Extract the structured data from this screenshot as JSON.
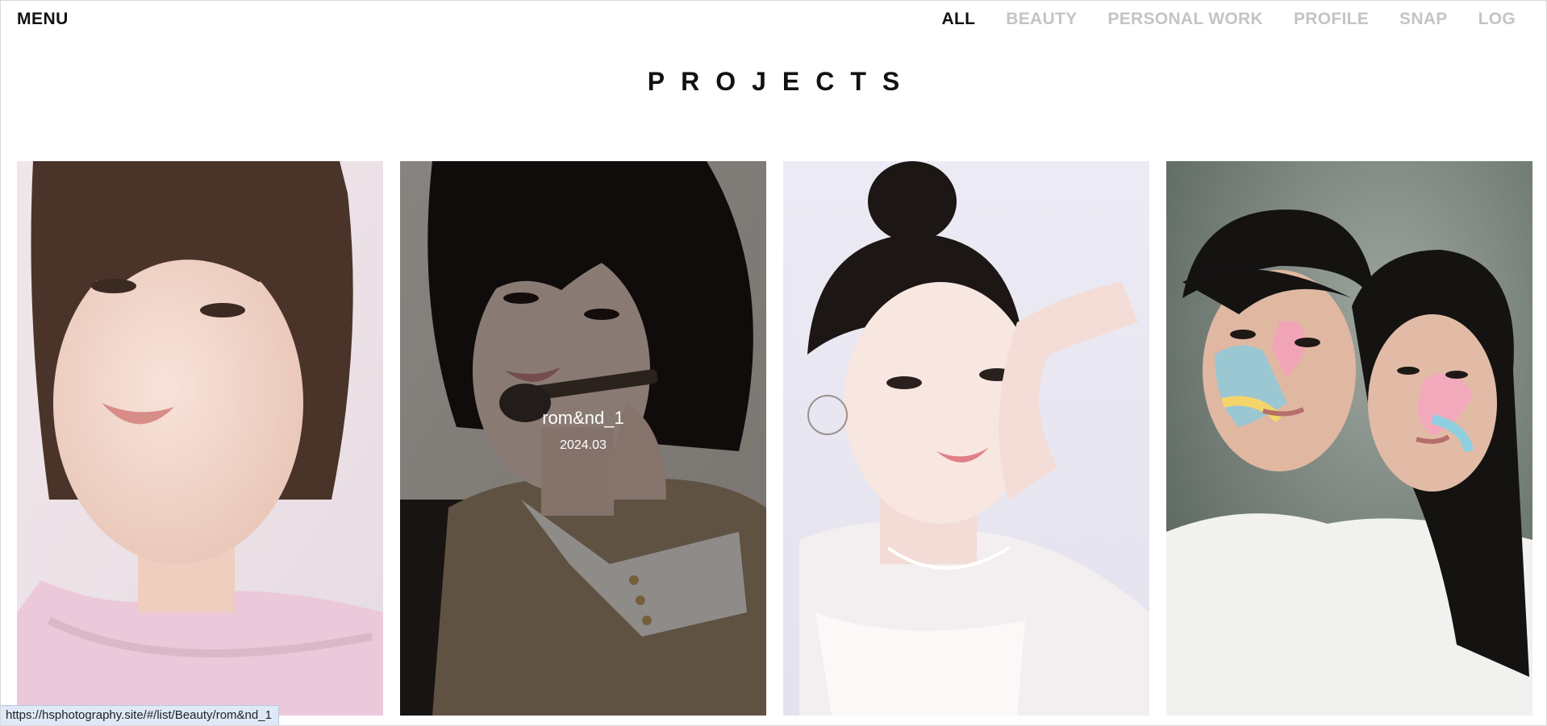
{
  "header": {
    "menu_label": "MENU",
    "nav": [
      {
        "label": "ALL",
        "active": true
      },
      {
        "label": "BEAUTY",
        "active": false
      },
      {
        "label": "PERSONAL WORK",
        "active": false
      },
      {
        "label": "PROFILE",
        "active": false
      },
      {
        "label": "SNAP",
        "active": false
      },
      {
        "label": "LOG",
        "active": false
      }
    ]
  },
  "page": {
    "title": "PROJECTS"
  },
  "projects": [
    {
      "hovered": false,
      "title": "",
      "date": ""
    },
    {
      "hovered": true,
      "title": "rom&nd_1",
      "date": "2024.03"
    },
    {
      "hovered": false,
      "title": "",
      "date": ""
    },
    {
      "hovered": false,
      "title": "",
      "date": ""
    }
  ],
  "status_bar": {
    "url": "https://hsphotography.site/#/list/Beauty/rom&nd_1"
  },
  "colors": {
    "nav_active": "#111111",
    "nav_inactive": "#c4c4c4",
    "overlay": "rgba(0,0,0,0.42)"
  }
}
